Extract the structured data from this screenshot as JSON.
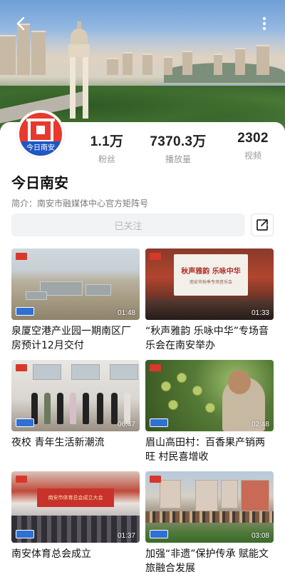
{
  "header": {
    "back_icon": "back-chevron-icon",
    "more_icon": "more-vertical-icon"
  },
  "profile": {
    "avatar_label": "今日南安",
    "name": "今日南安",
    "bio": "简介：南安市融媒体中心官方矩阵号",
    "follow_label": "已关注",
    "share_icon": "share-icon",
    "stats": [
      {
        "value": "1.1万",
        "label": "粉丝"
      },
      {
        "value": "7370.3万",
        "label": "播放量"
      },
      {
        "value": "2302",
        "label": "视频"
      }
    ]
  },
  "videos": [
    {
      "title": "泉厦空港产业园一期南区厂房预计12月交付",
      "duration": "01:48"
    },
    {
      "title": "“秋声雅韵 乐咏中华”专场音乐会在南安举办",
      "duration": "01:33"
    },
    {
      "title": "夜校 青年生活新潮流",
      "duration": "06:47"
    },
    {
      "title": "眉山高田村：百香果产销两旺 村民喜增收",
      "duration": "02:48"
    },
    {
      "title": "南安体育总会成立",
      "duration": "01:37"
    },
    {
      "title": "加强“非遗”保护传承 赋能文旅融合发展",
      "duration": "03:08"
    }
  ],
  "thumb_text": {
    "concert_title": "秋声雅韵 乐咏中华",
    "concert_sub": "南安市秋季专场音乐会",
    "sports_banner": "南安市体育总会成立大会"
  },
  "colors": {
    "brand_red": "#e8392d",
    "brand_blue": "#1f57c3",
    "muted": "#999999"
  }
}
